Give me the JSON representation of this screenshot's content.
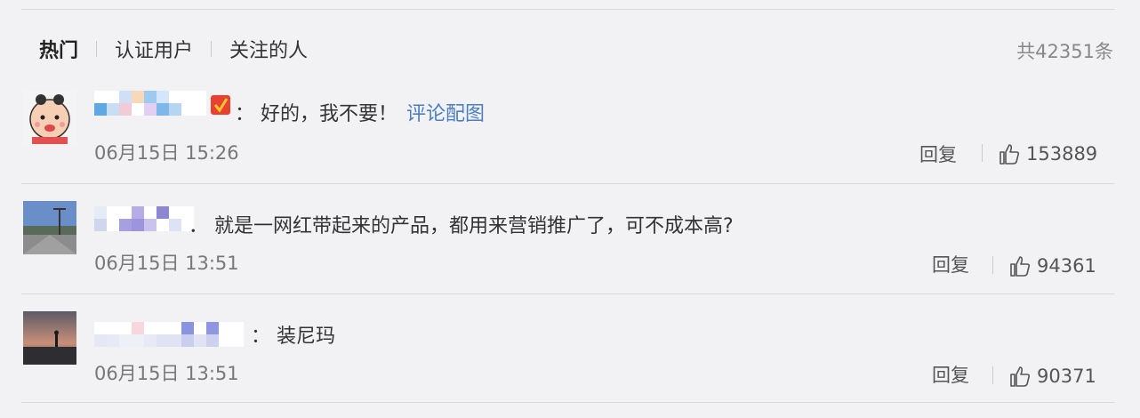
{
  "tabs": [
    {
      "label": "热门",
      "active": true
    },
    {
      "label": "认证用户",
      "active": false
    },
    {
      "label": "关注的人",
      "active": false
    }
  ],
  "total_count": "共42351条",
  "comments": [
    {
      "text": "：  好的，我不要！",
      "image_link": "评论配图",
      "time": "06月15日 15:26",
      "reply_label": "回复",
      "likes": "153889",
      "avatar_icon": "cartoon-girl-avatar",
      "badge_icon": "vip-badge-icon"
    },
    {
      "text": "．  就是一网红带起来的产品，都用来营销推广了，可不成本高?",
      "time": "06月15日 13:51",
      "reply_label": "回复",
      "likes": "94361",
      "avatar_icon": "street-photo-avatar"
    },
    {
      "text": "：  装尼玛",
      "time": "06月15日 13:51",
      "reply_label": "回复",
      "likes": "90371",
      "avatar_icon": "sunset-photo-avatar"
    }
  ],
  "colors": {
    "link": "#4a7fc3",
    "background": "#f2f2f5",
    "divider": "#d9d9de"
  }
}
